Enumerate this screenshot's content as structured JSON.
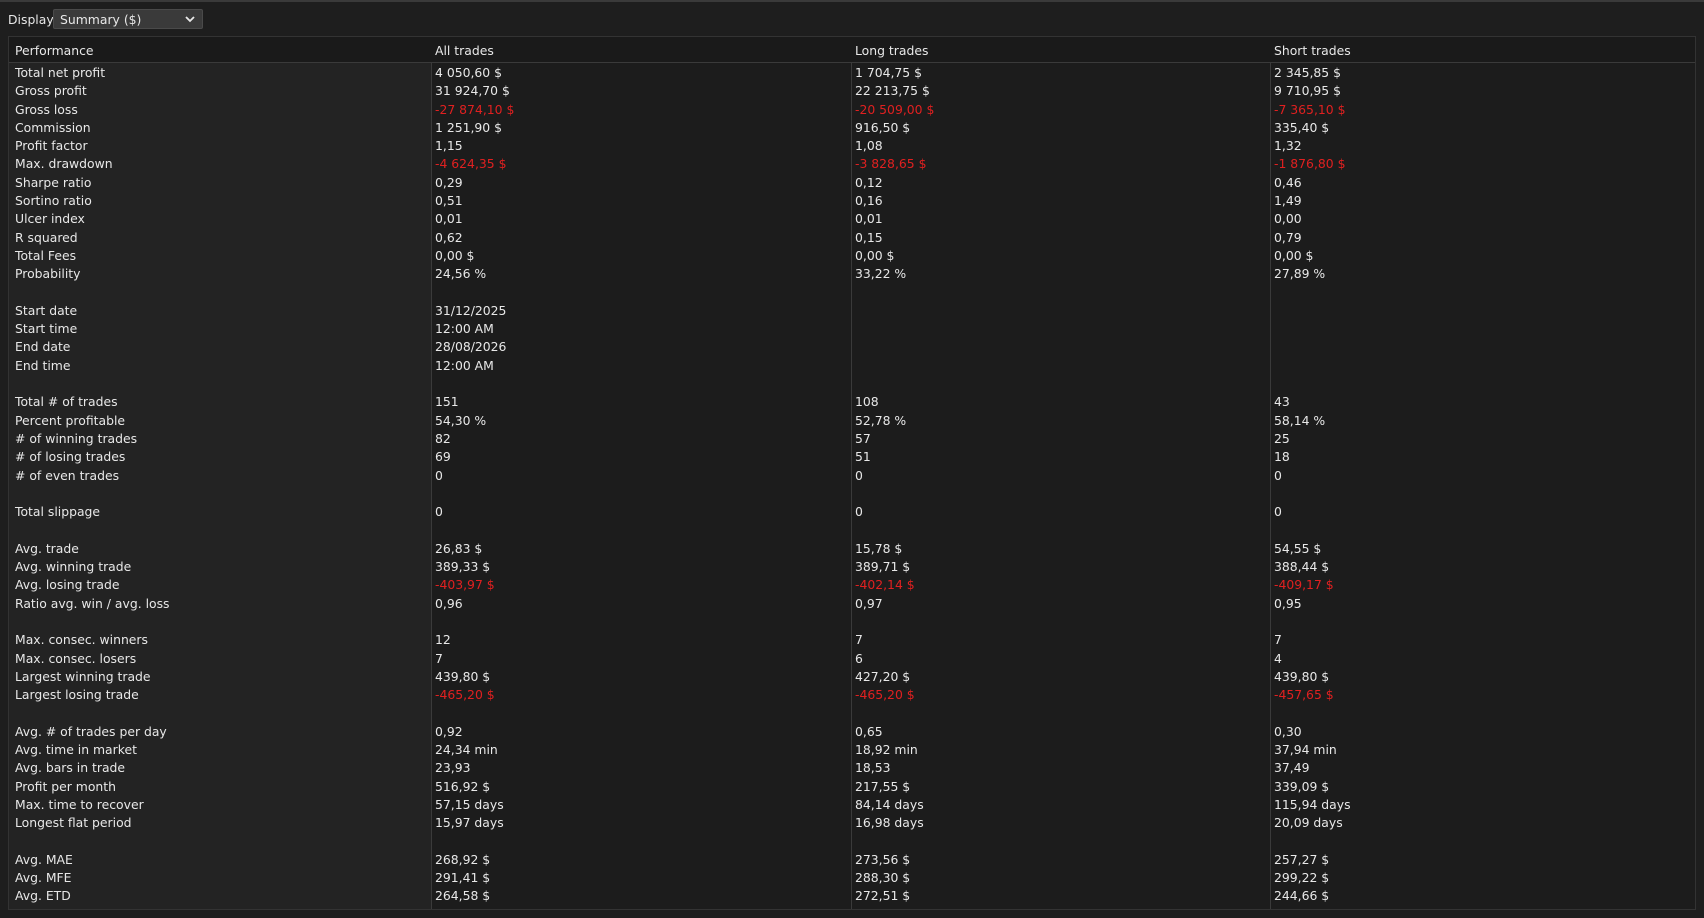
{
  "toolbar": {
    "display_label": "Display",
    "display_value": "Summary ($)"
  },
  "table": {
    "headers": [
      "Performance",
      "All trades",
      "Long trades",
      "Short trades"
    ],
    "negative_color": "#e02020",
    "rows": [
      {
        "label": "Total net profit",
        "values": [
          "4 050,60 $",
          "1 704,75 $",
          "2 345,85 $"
        ]
      },
      {
        "label": "Gross profit",
        "values": [
          "31 924,70 $",
          "22 213,75 $",
          "9 710,95 $"
        ]
      },
      {
        "label": "Gross loss",
        "values": [
          "-27 874,10 $",
          "-20 509,00 $",
          "-7 365,10 $"
        ],
        "negative": true
      },
      {
        "label": "Commission",
        "values": [
          "1 251,90 $",
          "916,50 $",
          "335,40 $"
        ]
      },
      {
        "label": "Profit factor",
        "values": [
          "1,15",
          "1,08",
          "1,32"
        ]
      },
      {
        "label": "Max. drawdown",
        "values": [
          "-4 624,35 $",
          "-3 828,65 $",
          "-1 876,80 $"
        ],
        "negative": true
      },
      {
        "label": "Sharpe ratio",
        "values": [
          "0,29",
          "0,12",
          "0,46"
        ]
      },
      {
        "label": "Sortino ratio",
        "values": [
          "0,51",
          "0,16",
          "1,49"
        ]
      },
      {
        "label": "Ulcer index",
        "values": [
          "0,01",
          "0,01",
          "0,00"
        ]
      },
      {
        "label": "R squared",
        "values": [
          "0,62",
          "0,15",
          "0,79"
        ]
      },
      {
        "label": "Total Fees",
        "values": [
          "0,00 $",
          "0,00 $",
          "0,00 $"
        ]
      },
      {
        "label": "Probability",
        "values": [
          "24,56 %",
          "33,22 %",
          "27,89 %"
        ]
      },
      {
        "label": "",
        "values": [
          "",
          "",
          ""
        ]
      },
      {
        "label": "Start date",
        "values": [
          "31/12/2025",
          "",
          ""
        ]
      },
      {
        "label": "Start time",
        "values": [
          "12:00 AM",
          "",
          ""
        ]
      },
      {
        "label": "End date",
        "values": [
          "28/08/2026",
          "",
          ""
        ]
      },
      {
        "label": "End time",
        "values": [
          "12:00 AM",
          "",
          ""
        ]
      },
      {
        "label": "",
        "values": [
          "",
          "",
          ""
        ]
      },
      {
        "label": "Total # of trades",
        "values": [
          "151",
          "108",
          "43"
        ]
      },
      {
        "label": "Percent profitable",
        "values": [
          "54,30 %",
          "52,78 %",
          "58,14 %"
        ]
      },
      {
        "label": "# of winning trades",
        "values": [
          "82",
          "57",
          "25"
        ]
      },
      {
        "label": "# of losing trades",
        "values": [
          "69",
          "51",
          "18"
        ]
      },
      {
        "label": "# of even trades",
        "values": [
          "0",
          "0",
          "0"
        ]
      },
      {
        "label": "",
        "values": [
          "",
          "",
          ""
        ]
      },
      {
        "label": "Total slippage",
        "values": [
          "0",
          "0",
          "0"
        ]
      },
      {
        "label": "",
        "values": [
          "",
          "",
          ""
        ]
      },
      {
        "label": "Avg. trade",
        "values": [
          "26,83 $",
          "15,78 $",
          "54,55 $"
        ]
      },
      {
        "label": "Avg. winning trade",
        "values": [
          "389,33 $",
          "389,71 $",
          "388,44 $"
        ]
      },
      {
        "label": "Avg. losing trade",
        "values": [
          "-403,97 $",
          "-402,14 $",
          "-409,17 $"
        ],
        "negative": true
      },
      {
        "label": "Ratio avg. win / avg. loss",
        "values": [
          "0,96",
          "0,97",
          "0,95"
        ]
      },
      {
        "label": "",
        "values": [
          "",
          "",
          ""
        ]
      },
      {
        "label": "Max. consec. winners",
        "values": [
          "12",
          "7",
          "7"
        ]
      },
      {
        "label": "Max. consec. losers",
        "values": [
          "7",
          "6",
          "4"
        ]
      },
      {
        "label": "Largest winning trade",
        "values": [
          "439,80 $",
          "427,20 $",
          "439,80 $"
        ]
      },
      {
        "label": "Largest losing trade",
        "values": [
          "-465,20 $",
          "-465,20 $",
          "-457,65 $"
        ],
        "negative": true
      },
      {
        "label": "",
        "values": [
          "",
          "",
          ""
        ]
      },
      {
        "label": "Avg. # of trades per day",
        "values": [
          "0,92",
          "0,65",
          "0,30"
        ]
      },
      {
        "label": "Avg. time in market",
        "values": [
          "24,34 min",
          "18,92 min",
          "37,94 min"
        ]
      },
      {
        "label": "Avg. bars in trade",
        "values": [
          "23,93",
          "18,53",
          "37,49"
        ]
      },
      {
        "label": "Profit per month",
        "values": [
          "516,92 $",
          "217,55 $",
          "339,09 $"
        ]
      },
      {
        "label": "Max. time to recover",
        "values": [
          "57,15 days",
          "84,14 days",
          "115,94 days"
        ]
      },
      {
        "label": "Longest flat period",
        "values": [
          "15,97 days",
          "16,98 days",
          "20,09 days"
        ]
      },
      {
        "label": "",
        "values": [
          "",
          "",
          ""
        ]
      },
      {
        "label": "Avg. MAE",
        "values": [
          "268,92 $",
          "273,56 $",
          "257,27 $"
        ]
      },
      {
        "label": "Avg. MFE",
        "values": [
          "291,41 $",
          "288,30 $",
          "299,22 $"
        ]
      },
      {
        "label": "Avg. ETD",
        "values": [
          "264,58 $",
          "272,51 $",
          "244,66 $"
        ]
      }
    ]
  }
}
